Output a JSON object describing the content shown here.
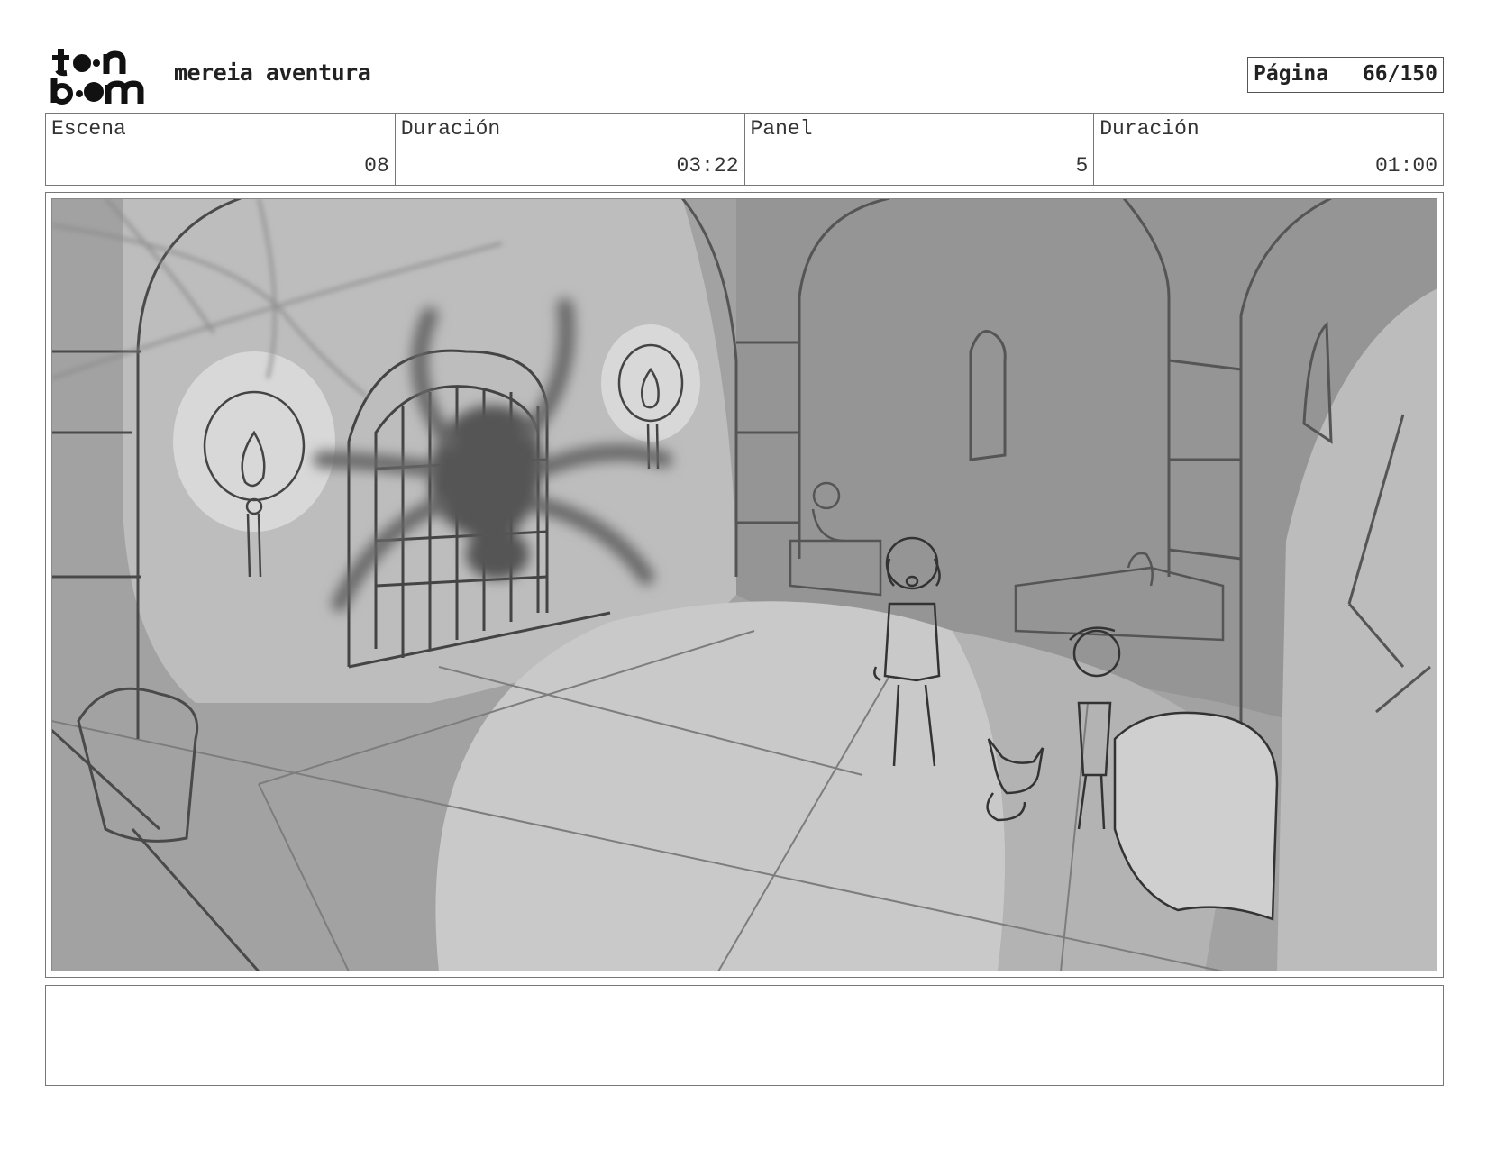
{
  "header": {
    "logo_alt": "toon boom",
    "project_title": "mereia aventura",
    "page_label": "Página",
    "page_value": "66/150"
  },
  "info": [
    {
      "label": "Escena",
      "value": "08"
    },
    {
      "label": "Duración",
      "value": "03:22"
    },
    {
      "label": "Panel",
      "value": "5"
    },
    {
      "label": "Duración",
      "value": "01:00"
    }
  ],
  "panel": {
    "description": ""
  },
  "notes": {
    "text": ""
  }
}
